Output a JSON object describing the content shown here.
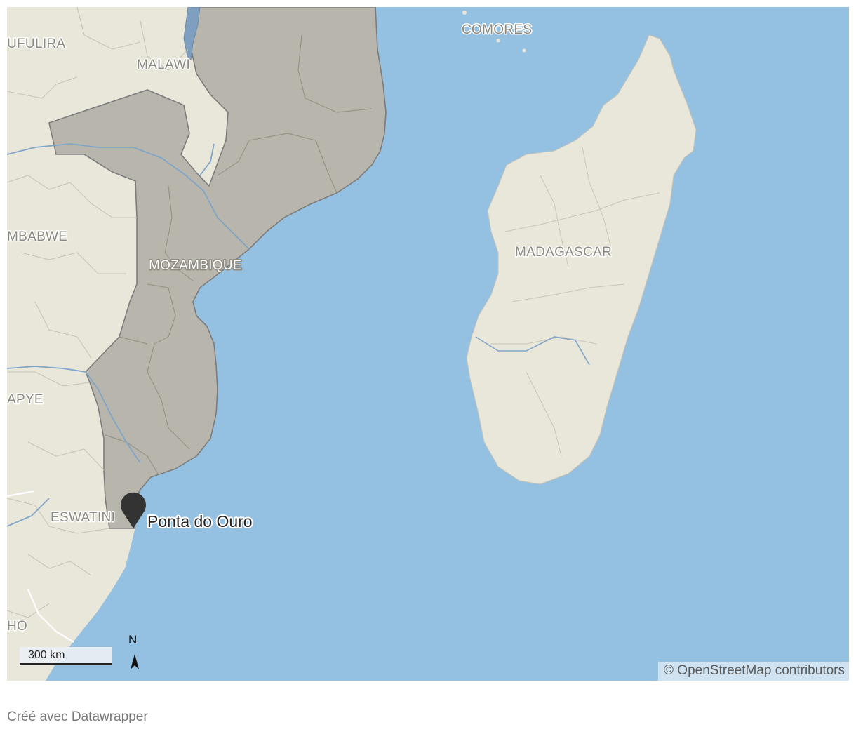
{
  "map": {
    "labels": {
      "comores": "COMORES",
      "ufulira": "UFULIRA",
      "malawi": "MALAWI",
      "zimbabwe": "MBABWE",
      "mozambique": "MOZAMBIQUE",
      "madagascar": "MADAGASCAR",
      "apye": "APYE",
      "eswatini": "ESWATINI",
      "lesotho": "HO"
    },
    "marker": {
      "label": "Ponta do Ouro",
      "icon": "map-pin-icon"
    },
    "scale": {
      "label": "300 km"
    },
    "north": {
      "label": "N"
    },
    "attribution": "© OpenStreetMap contributors",
    "colors": {
      "water": "#94c0e2",
      "land": "#e9e6da",
      "highlight": "#b8b6ac",
      "border": "#808080",
      "marker": "#333333"
    }
  },
  "footer": {
    "credit": "Créé avec Datawrapper"
  }
}
